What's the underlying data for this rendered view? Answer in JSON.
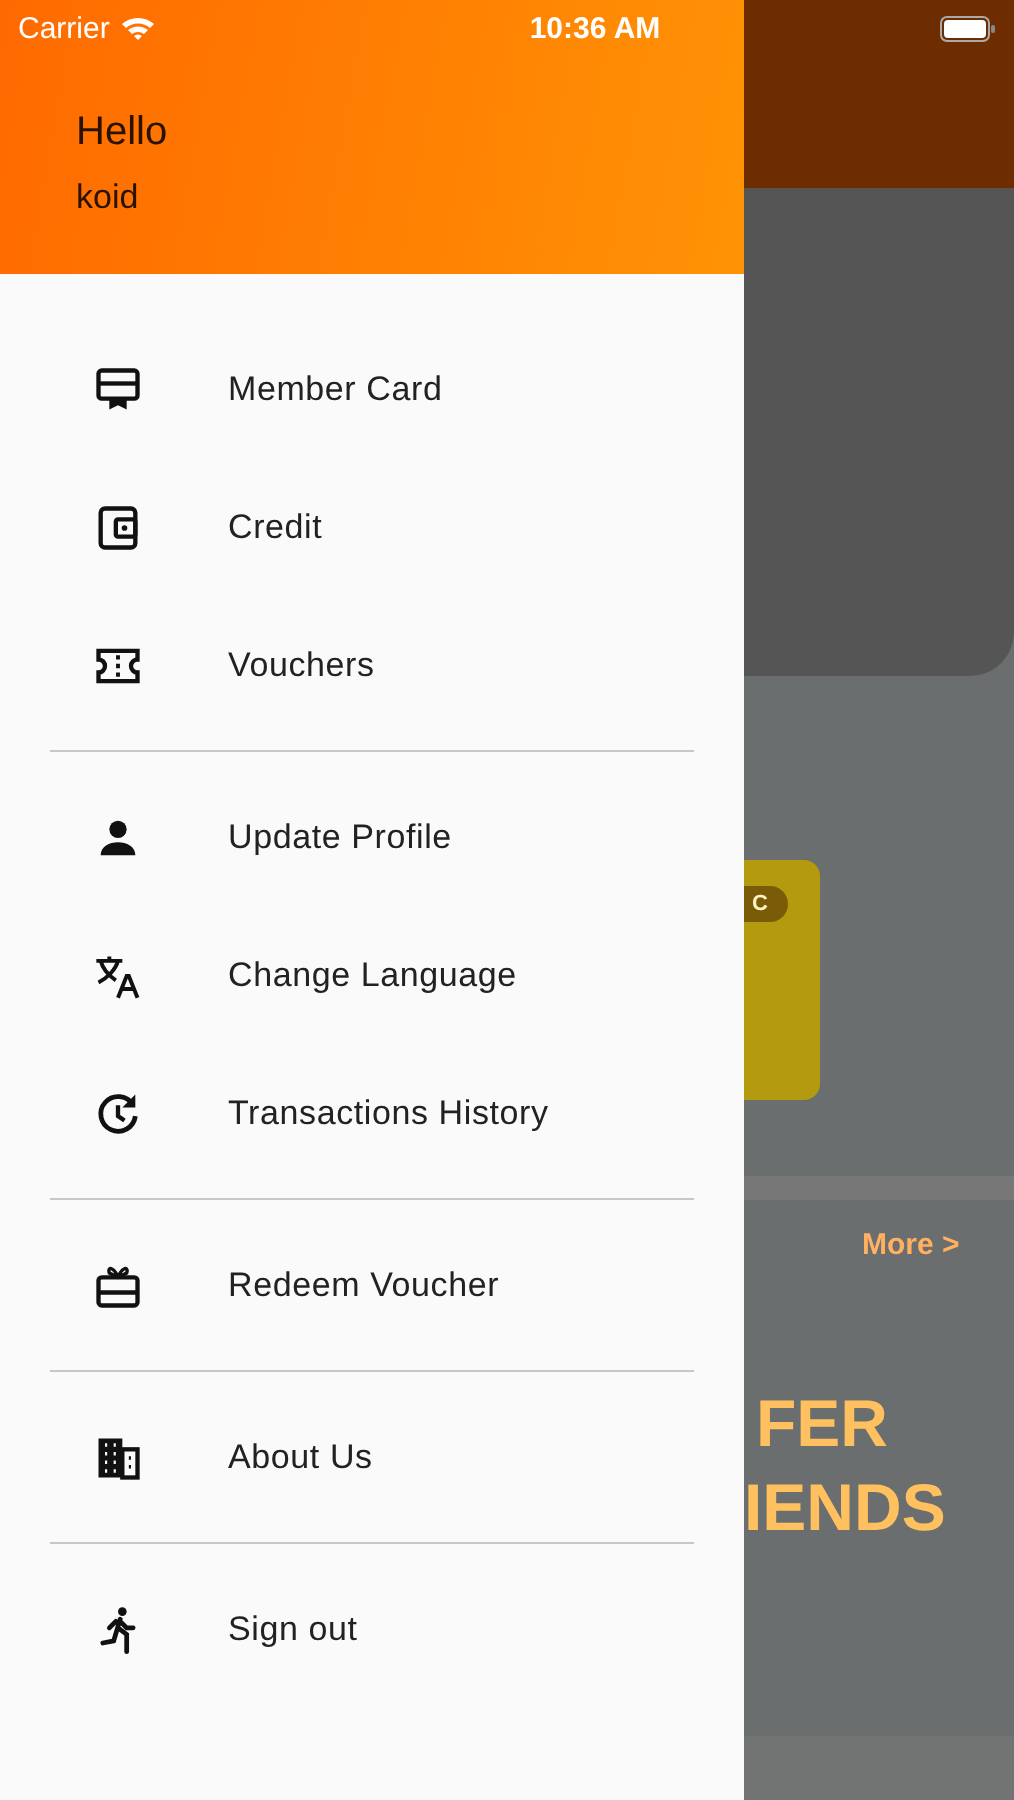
{
  "status_bar": {
    "carrier": "Carrier",
    "time": "10:36 AM"
  },
  "drawer": {
    "greeting": "Hello",
    "user_name": "koid",
    "groups": [
      {
        "items": [
          {
            "kind": "member-card",
            "label": "Member Card"
          },
          {
            "kind": "wallet",
            "label": "Credit"
          },
          {
            "kind": "ticket",
            "label": "Vouchers"
          }
        ]
      },
      {
        "items": [
          {
            "kind": "person",
            "label": "Update Profile"
          },
          {
            "kind": "translate",
            "label": "Change Language"
          },
          {
            "kind": "history",
            "label": "Transactions History"
          }
        ]
      },
      {
        "items": [
          {
            "kind": "gift",
            "label": "Redeem Voucher"
          }
        ]
      },
      {
        "items": [
          {
            "kind": "building",
            "label": "About Us"
          }
        ]
      },
      {
        "items": [
          {
            "kind": "runner",
            "label": "Sign out"
          }
        ]
      }
    ]
  },
  "background": {
    "card_badge": "C",
    "more_link": "More >",
    "banner_lines": [
      "FER",
      "IENDS"
    ]
  }
}
